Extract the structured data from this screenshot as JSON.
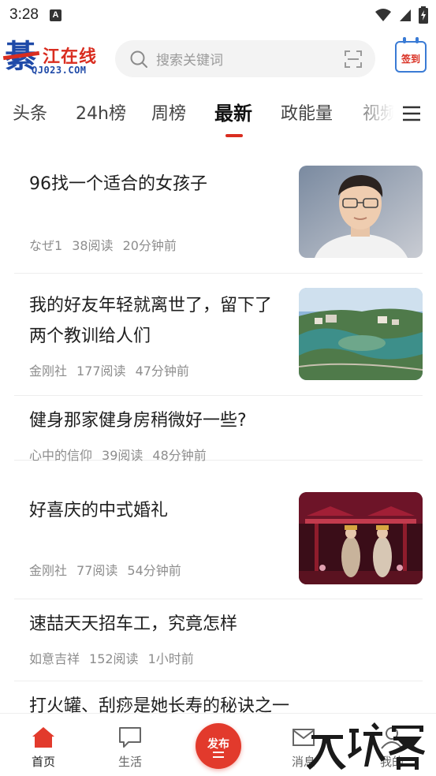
{
  "status_bar": {
    "time": "3:28",
    "notification_badge": "A"
  },
  "header": {
    "logo": {
      "char": "綦",
      "name": "江在线",
      "url": "QJ023.COM"
    },
    "search_placeholder": "搜索关键词",
    "signin_label": "签到"
  },
  "tabs": {
    "items": [
      "头条",
      "24h榜",
      "周榜",
      "最新",
      "政能量",
      "视频"
    ],
    "active": "最新"
  },
  "articles": [
    {
      "title": "96找一个适合的女孩子",
      "author": "なぜ1",
      "reads": "38阅读",
      "time": "20分钟前",
      "thumb": "portrait"
    },
    {
      "title": "我的好友年轻就离世了，留下了两个教训给人们",
      "author": "金刚社",
      "reads": "177阅读",
      "time": "47分钟前",
      "thumb": "aerial-river-city"
    },
    {
      "title": "健身那家健身房稍微好一些?",
      "author": "心中的信仰",
      "reads": "39阅读",
      "time": "48分钟前",
      "thumb": null
    },
    {
      "title": "好喜庆的中式婚礼",
      "author": "金刚社",
      "reads": "77阅读",
      "time": "54分钟前",
      "thumb": "chinese-wedding-stage"
    },
    {
      "title": "速喆天天招车工，究竟怎样",
      "author": "如意吉祥",
      "reads": "152阅读",
      "time": "1小时前",
      "thumb": null
    },
    {
      "title": "打火罐、刮痧是她长寿的秘诀之一",
      "author": "",
      "reads": "",
      "time": "",
      "thumb": null
    }
  ],
  "bottom_nav": {
    "items": [
      {
        "label": "首页",
        "icon": "home-icon",
        "active": true
      },
      {
        "label": "生活",
        "icon": "chat-bubble-icon",
        "active": false
      },
      {
        "label": "消息",
        "icon": "mail-icon",
        "active": false
      },
      {
        "label": "我的",
        "icon": "user-icon",
        "active": false
      }
    ],
    "publish_label": "发布"
  },
  "watermark_text": "大玩客",
  "colors": {
    "accent": "#d92d20",
    "brand_blue": "#1f4aa8",
    "meta_gray": "#8d8d8d"
  }
}
